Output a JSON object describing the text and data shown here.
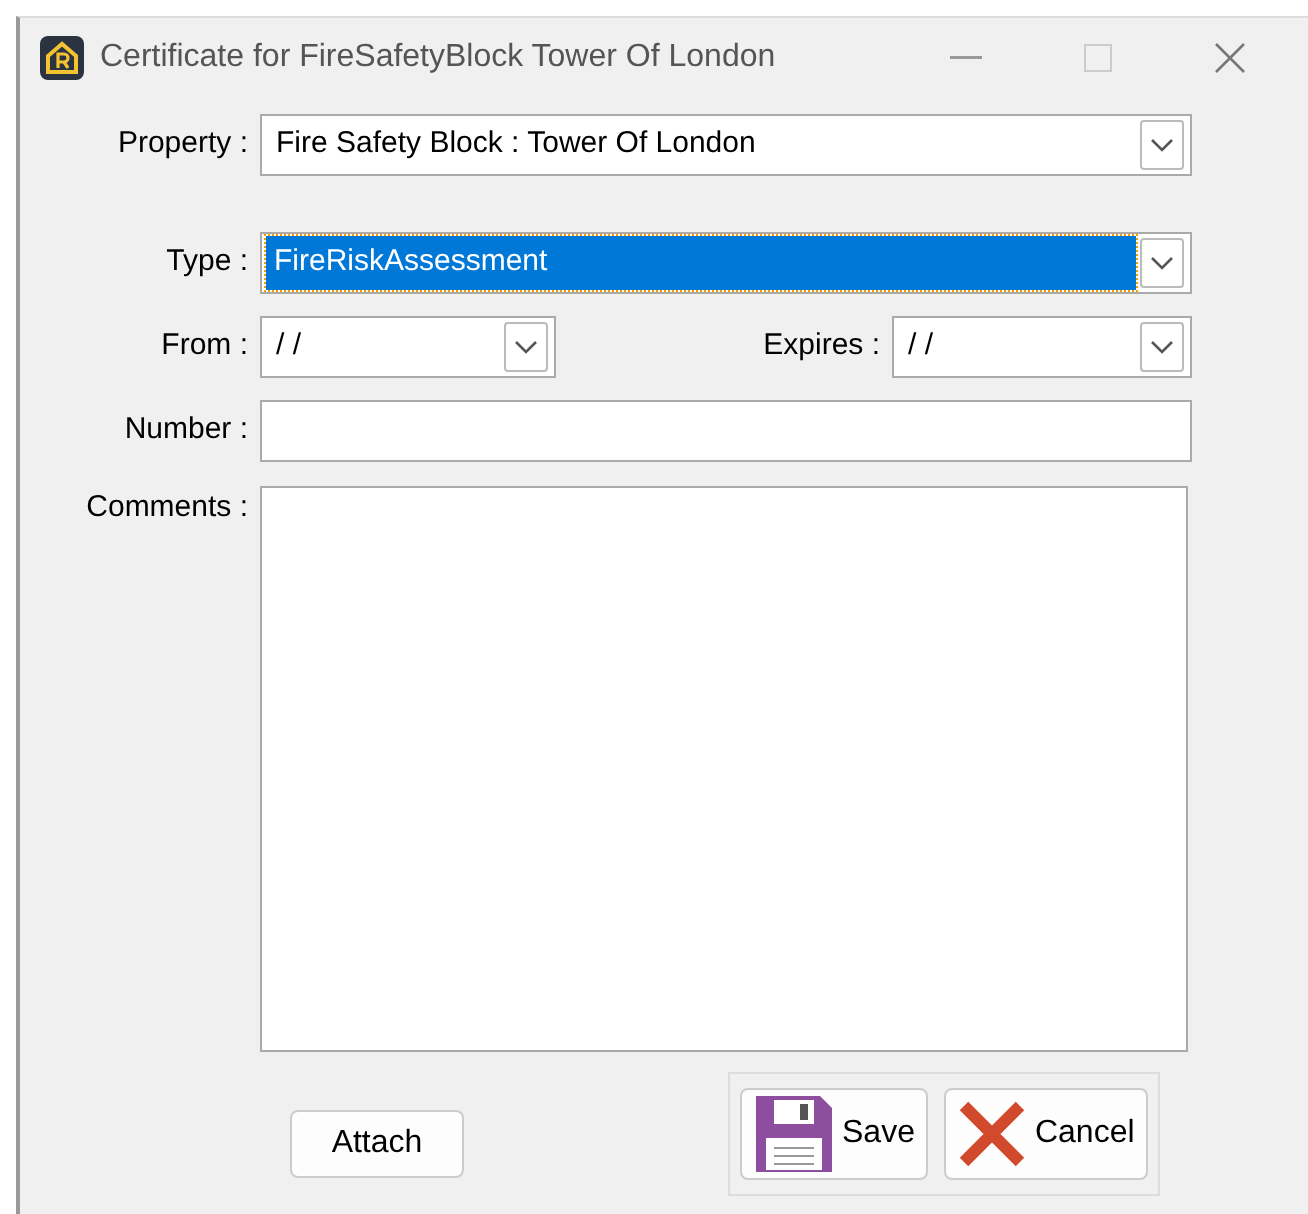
{
  "window": {
    "title": "Certificate for FireSafetyBlock Tower Of London"
  },
  "property": {
    "label": "Property :",
    "value": "Fire Safety Block : Tower Of London"
  },
  "type": {
    "label": "Type :",
    "value": "FireRiskAssessment",
    "highlighted": true
  },
  "from": {
    "label": "From :",
    "value": "/ /"
  },
  "expires": {
    "label": "Expires :",
    "value": "/ /"
  },
  "number": {
    "label": "Number :"
  },
  "comments": {
    "label": "Comments :"
  },
  "buttons": [
    {
      "kind": "plain",
      "label": "Attach"
    },
    {
      "kind": "save",
      "label": "Save"
    },
    {
      "kind": "cancel",
      "label": "Cancel"
    }
  ]
}
